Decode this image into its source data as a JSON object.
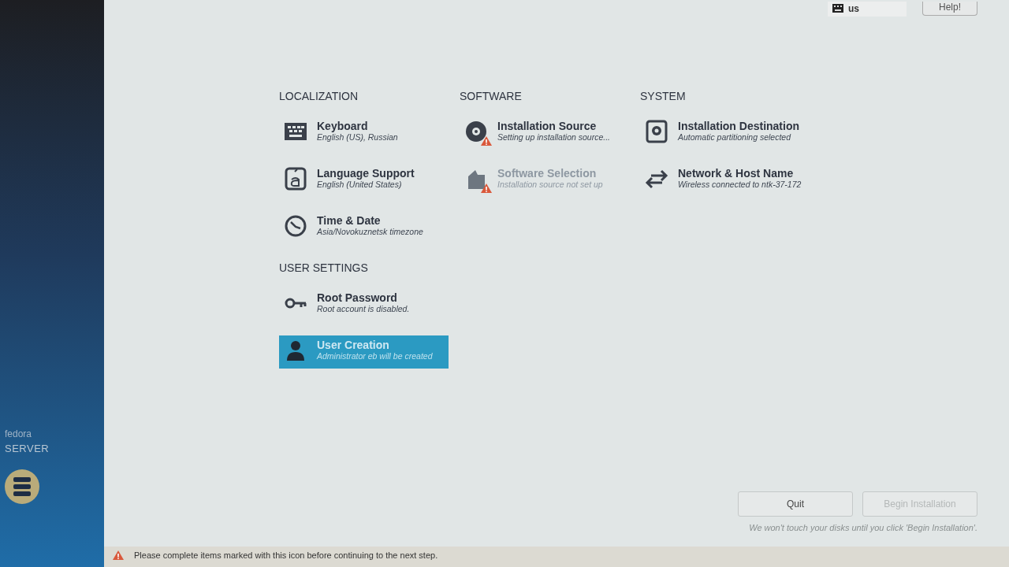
{
  "sidebar": {
    "brand": "fedora",
    "product": "SERVER"
  },
  "topbar": {
    "keyboard_layout": "us",
    "help_button": "Help!"
  },
  "sections": [
    {
      "title": "LOCALIZATION",
      "items": [
        {
          "kind": "keyboard",
          "title": "Keyboard",
          "status": "English (US), Russian",
          "warning": false,
          "disabled": false,
          "selected": false
        },
        {
          "kind": "language",
          "title": "Language Support",
          "status": "English (United States)",
          "warning": false,
          "disabled": false,
          "selected": false
        },
        {
          "kind": "clock",
          "title": "Time & Date",
          "status": "Asia/Novokuznetsk timezone",
          "warning": false,
          "disabled": false,
          "selected": false
        }
      ]
    },
    {
      "title": "SOFTWARE",
      "items": [
        {
          "kind": "disc",
          "title": "Installation Source",
          "status": "Setting up installation source...",
          "warning": true,
          "disabled": false,
          "selected": false
        },
        {
          "kind": "package",
          "title": "Software Selection",
          "status": "Installation source not set up",
          "warning": true,
          "disabled": true,
          "selected": false
        }
      ]
    },
    {
      "title": "SYSTEM",
      "items": [
        {
          "kind": "drive",
          "title": "Installation Destination",
          "status": "Automatic partitioning selected",
          "warning": false,
          "disabled": false,
          "selected": false
        },
        {
          "kind": "network",
          "title": "Network & Host Name",
          "status": "Wireless connected to ntk-37-172",
          "warning": false,
          "disabled": false,
          "selected": false
        }
      ]
    },
    {
      "title": "USER SETTINGS",
      "items": [
        {
          "kind": "key",
          "title": "Root Password",
          "status": "Root account is disabled.",
          "warning": false,
          "disabled": false,
          "selected": false
        },
        {
          "kind": "user",
          "title": "User Creation",
          "status": "Administrator eb will be created",
          "warning": false,
          "disabled": false,
          "selected": true
        }
      ]
    }
  ],
  "buttons": [
    {
      "label": "Quit",
      "disabled": false
    },
    {
      "label": "Begin Installation",
      "disabled": true
    }
  ],
  "footer_note": "We won't touch your disks until you click 'Begin Installation'.",
  "warning_bar": "Please complete items marked with this icon before continuing to the next step."
}
